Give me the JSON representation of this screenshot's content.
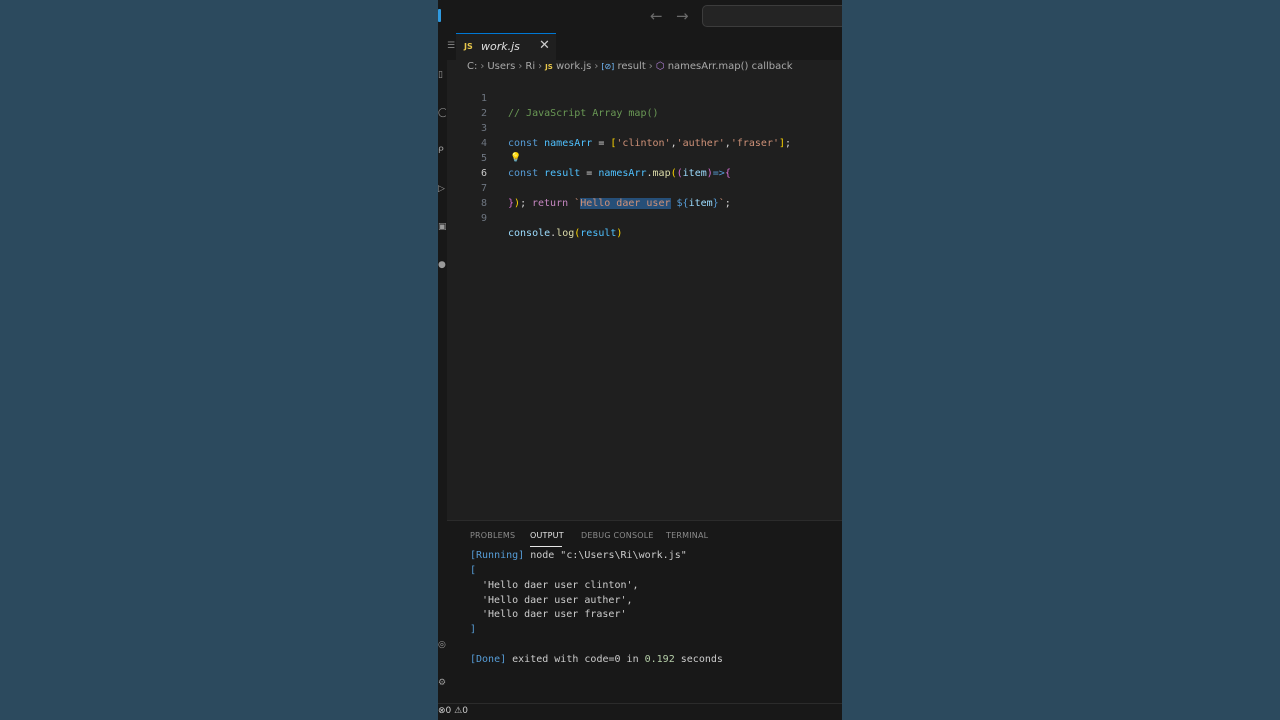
{
  "titlebar": {
    "back_icon": "arrow-left-icon",
    "forward_icon": "arrow-right-icon",
    "search_placeholder": ""
  },
  "tab": {
    "badge": "JS",
    "filename": "work.js",
    "close_glyph": "✕"
  },
  "breadcrumbs": {
    "drive": "C:",
    "users": "Users",
    "user": "Ri",
    "file_badge": "JS",
    "file": "work.js",
    "symbol_badge": "[⊘]",
    "symbol": "result",
    "callback_badge": "⬡",
    "callback": "namesArr.map() callback"
  },
  "editor": {
    "active_line": 6,
    "line_numbers": [
      "1",
      "2",
      "3",
      "4",
      "5",
      "6",
      "7",
      "8",
      "9"
    ],
    "line1": "// JavaScript Array map()",
    "line3": {
      "kw": "const",
      "name": "namesArr",
      "eq": " = ",
      "open": "[",
      "s1": "'clinton'",
      "s2": "'auther'",
      "s3": "'fraser'",
      "close": "]",
      "end": ";"
    },
    "line5": {
      "kw": "const",
      "name": "result",
      "eq": " = ",
      "obj": "namesArr",
      "dot": ".",
      "fn": "map",
      "p1": "(",
      "p2": "(",
      "param": "item",
      "p3": ")",
      "arrow": "=>",
      "brace": "{"
    },
    "line6": {
      "ret": "return",
      "tick": "`",
      "selected": "Hello daer user",
      "space": " ",
      "tpl_open": "${",
      "tpl_var": "item",
      "tpl_close": "}",
      "tick_end": "`",
      "end": ";"
    },
    "line7": {
      "brace": "}",
      "paren": ")",
      "end": ";"
    },
    "line9": {
      "obj": "console",
      "dot": ".",
      "fn": "log",
      "open": "(",
      "arg": "result",
      "close": ")"
    }
  },
  "panel": {
    "tabs": [
      "PROBLEMS",
      "OUTPUT",
      "DEBUG CONSOLE",
      "TERMINAL"
    ],
    "active_tab": "OUTPUT",
    "output": {
      "running_tag": "[Running]",
      "running_cmd": " node \"c:\\Users\\Ri\\work.js\"",
      "open": "[",
      "items": [
        "'Hello daer user clinton'",
        "'Hello daer user auther'",
        "'Hello daer user fraser'"
      ],
      "seps": [
        ",",
        ",",
        ""
      ],
      "close": "]",
      "done_tag": "[Done]",
      "done_text": " exited with ",
      "code": "code=0",
      "in_text": " in ",
      "seconds": "0.192",
      "seconds_label": " seconds"
    }
  },
  "status": {
    "errors": "0",
    "warnings": "0"
  }
}
